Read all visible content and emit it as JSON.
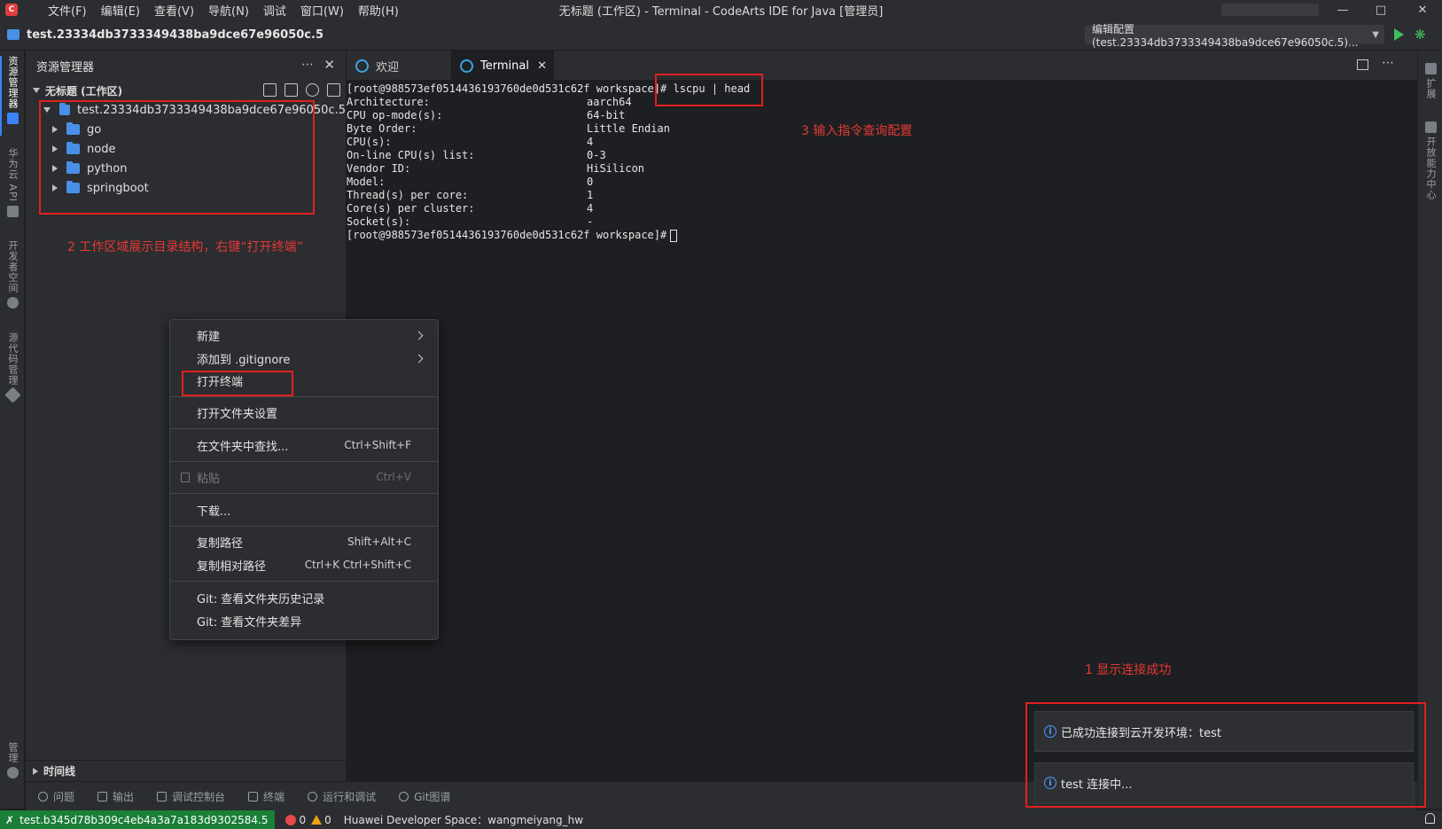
{
  "titlebar": {
    "menus": [
      "文件(F)",
      "编辑(E)",
      "查看(V)",
      "导航(N)",
      "调试",
      "窗口(W)",
      "帮助(H)"
    ],
    "title": "无标题 (工作区) - Terminal - CodeArts IDE for Java [管理员]"
  },
  "projectbar": {
    "name": "test.23334db3733349438ba9dce67e96050c.5",
    "run_config": "编辑配置(test.23334db3733349438ba9dce67e96050c.5)..."
  },
  "activitybar": {
    "explorer": "资源管理器",
    "huawei_api": "华为云 API",
    "dev_space": "开发者空间",
    "source_mgmt": "源代码管理",
    "manage": "管理"
  },
  "rightbar": {
    "extensions": "扩展",
    "capability_center": "开放能力中心"
  },
  "explorer": {
    "title": "资源管理器",
    "workspace": "无标题 (工作区)",
    "root_folder": "test.23334db3733349438ba9dce67e96050c.5",
    "folders": [
      "go",
      "node",
      "python",
      "springboot"
    ],
    "timeline": "时间线"
  },
  "tabs": {
    "welcome": "欢迎",
    "terminal": "Terminal"
  },
  "terminal": {
    "prompt": "[root@988573ef0514436193760de0d531c62f workspace]#",
    "command": "lscpu | head",
    "rows": [
      {
        "k": "Architecture:",
        "v": "aarch64"
      },
      {
        "k": "CPU op-mode(s):",
        "v": "64-bit"
      },
      {
        "k": "Byte Order:",
        "v": "Little Endian"
      },
      {
        "k": "CPU(s):",
        "v": "4"
      },
      {
        "k": "On-line CPU(s) list:",
        "v": "0-3"
      },
      {
        "k": "Vendor ID:",
        "v": "HiSilicon"
      },
      {
        "k": "Model:",
        "v": "0"
      },
      {
        "k": "Thread(s) per core:",
        "v": "1"
      },
      {
        "k": "Core(s) per cluster:",
        "v": "4"
      },
      {
        "k": "Socket(s):",
        "v": "-"
      }
    ]
  },
  "annotations": {
    "a1": "1 显示连接成功",
    "a2": "2 工作区域展示目录结构，右键“打开终端”",
    "a3": "3 输入指令查询配置"
  },
  "context_menu": {
    "new": "新建",
    "add_gitignore": "添加到 .gitignore",
    "open_terminal": "打开终端",
    "open_folder_settings": "打开文件夹设置",
    "find_in_folder": "在文件夹中查找...",
    "find_in_folder_sc": "Ctrl+Shift+F",
    "paste": "粘贴",
    "paste_sc": "Ctrl+V",
    "download": "下载...",
    "copy_path": "复制路径",
    "copy_path_sc": "Shift+Alt+C",
    "copy_rel_path": "复制相对路径",
    "copy_rel_path_sc": "Ctrl+K Ctrl+Shift+C",
    "git_history": "Git: 查看文件夹历史记录",
    "git_diff": "Git: 查看文件夹差异"
  },
  "panel_tabs": [
    "问题",
    "输出",
    "调试控制台",
    "终端",
    "运行和调试",
    "Git图谱"
  ],
  "notifications": {
    "connected": "已成功连接到云开发环境：test",
    "connecting": "test 连接中..."
  },
  "statusbar": {
    "remote": "test.b345d78b309c4eb4a3a7a183d9302584.5",
    "errors": "0",
    "warnings": "0",
    "dev_space": "Huawei Developer Space：wangmeiyang_hw"
  },
  "colors": {
    "accent": "#3b82f6",
    "annotation": "#e02020",
    "remote_green": "#1a7f37"
  }
}
